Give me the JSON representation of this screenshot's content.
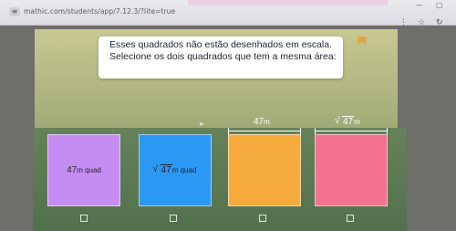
{
  "browser": {
    "url": "mathic.com/students/app/7.12.3/?lite=true",
    "window_minimize": "—",
    "window_restore": "▢",
    "toolbar_icons": {
      "extension": "⋮",
      "bookmark_star": "☆",
      "reload": "↻"
    }
  },
  "question": {
    "line1": "Esses quadrados não estão desenhados em escala.",
    "line2": "Selecione os dois quadrados que tem a mesma área:"
  },
  "squares": [
    {
      "label_value": "47",
      "label_unit": "m quad",
      "color": "#c58df2"
    },
    {
      "label_value": "47",
      "label_unit": "m quad",
      "sqrt": true,
      "color": "#2b98f4"
    },
    {
      "side_value": "47",
      "side_unit": "m",
      "color": "#f6ac3c"
    },
    {
      "side_value": "47",
      "side_unit": "m",
      "sqrt": true,
      "color": "#f3728f"
    }
  ],
  "icons": {
    "tune": "tune-icon",
    "bookmark": "bookmark-icon",
    "cursor": "mouse-cursor-icon",
    "checkbox": "checkbox-icon"
  }
}
